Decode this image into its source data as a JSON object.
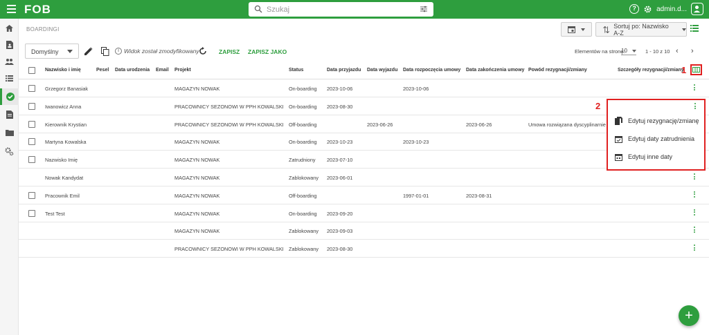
{
  "app": {
    "logo": "FOB"
  },
  "search": {
    "placeholder": "Szukaj"
  },
  "user": {
    "name": "admin.d..."
  },
  "breadcrumb": "BOARDINGI",
  "sort": {
    "label": "Sortuj po: Nazwisko A-Z"
  },
  "toolbar": {
    "view_name": "Domyślny",
    "modified_text": "Widok został zmodyfikowany",
    "save_label": "ZAPISZ",
    "save_as_label": "ZAPISZ JAKO"
  },
  "pager": {
    "per_page_label": "Elementów na stronę:",
    "per_page_value": "10",
    "range": "1 - 10 z 10"
  },
  "table": {
    "headers": [
      "Nazwisko i imię",
      "Pesel",
      "Data urodzenia",
      "Email",
      "Projekt",
      "Status",
      "Data przyjazdu",
      "Data wyjazdu",
      "Data rozpoczęcia umowy",
      "Data zakończenia umowy",
      "Powód rezygnacji/zmiany",
      "Szczegóły rezygnacji/zmiany"
    ],
    "rows": [
      {
        "name": "Grzegorz Banasiak",
        "project": "MAGAZYN NOWAK",
        "status": "On-boarding",
        "arrival": "2023-10-06",
        "departure": "",
        "start": "2023-10-06",
        "end": "",
        "reason": "",
        "checkbox": true
      },
      {
        "name": "Iwanowicz Anna",
        "project": "PRACOWNICY SEZONOWI W PPH KOWALSKI",
        "status": "On-boarding",
        "arrival": "2023-08-30",
        "departure": "",
        "start": "",
        "end": "",
        "reason": "",
        "checkbox": true
      },
      {
        "name": "Kierownik Krystian",
        "project": "PRACOWNICY SEZONOWI W PPH KOWALSKI",
        "status": "Off-boarding",
        "arrival": "",
        "departure": "2023-06-26",
        "start": "",
        "end": "2023-06-26",
        "reason": "Umowa rozwiązana dyscyplinarnie",
        "checkbox": true
      },
      {
        "name": "Martyna Kowalska",
        "project": "MAGAZYN NOWAK",
        "status": "On-boarding",
        "arrival": "2023-10-23",
        "departure": "",
        "start": "2023-10-23",
        "end": "",
        "reason": "",
        "checkbox": true
      },
      {
        "name": "Nazwisko Imię",
        "project": "MAGAZYN NOWAK",
        "status": "Zatrudniony",
        "arrival": "2023-07-10",
        "departure": "",
        "start": "",
        "end": "",
        "reason": "",
        "checkbox": true
      },
      {
        "name": "Nowak Kandydat",
        "project": "MAGAZYN NOWAK",
        "status": "Zablokowany",
        "arrival": "2023-06-01",
        "departure": "",
        "start": "",
        "end": "",
        "reason": "",
        "checkbox": false
      },
      {
        "name": "Pracownik Emil",
        "project": "MAGAZYN NOWAK",
        "status": "Off-boarding",
        "arrival": "",
        "departure": "",
        "start": "1997-01-01",
        "end": "2023-08-31",
        "reason": "",
        "checkbox": true
      },
      {
        "name": "Test Test",
        "project": "MAGAZYN NOWAK",
        "status": "On-boarding",
        "arrival": "2023-09-20",
        "departure": "",
        "start": "",
        "end": "",
        "reason": "",
        "checkbox": true
      },
      {
        "name": "",
        "project": "MAGAZYN NOWAK",
        "status": "Zablokowany",
        "arrival": "2023-09-03",
        "departure": "",
        "start": "",
        "end": "",
        "reason": "",
        "checkbox": false
      },
      {
        "name": "",
        "project": "PRACOWNICY SEZONOWI W PPH KOWALSKI",
        "status": "Zablokowany",
        "arrival": "2023-08-30",
        "departure": "",
        "start": "",
        "end": "",
        "reason": "",
        "checkbox": false
      }
    ]
  },
  "context_menu": {
    "items": [
      "Edytuj rezygnację/zmianę",
      "Edytuj daty zatrudnienia",
      "Edytuj inne daty"
    ]
  },
  "markers": {
    "one": "1",
    "two": "2"
  },
  "fab": {
    "label": "+"
  },
  "colors": {
    "brand": "#2e9e3e",
    "highlight": "#e02020"
  }
}
